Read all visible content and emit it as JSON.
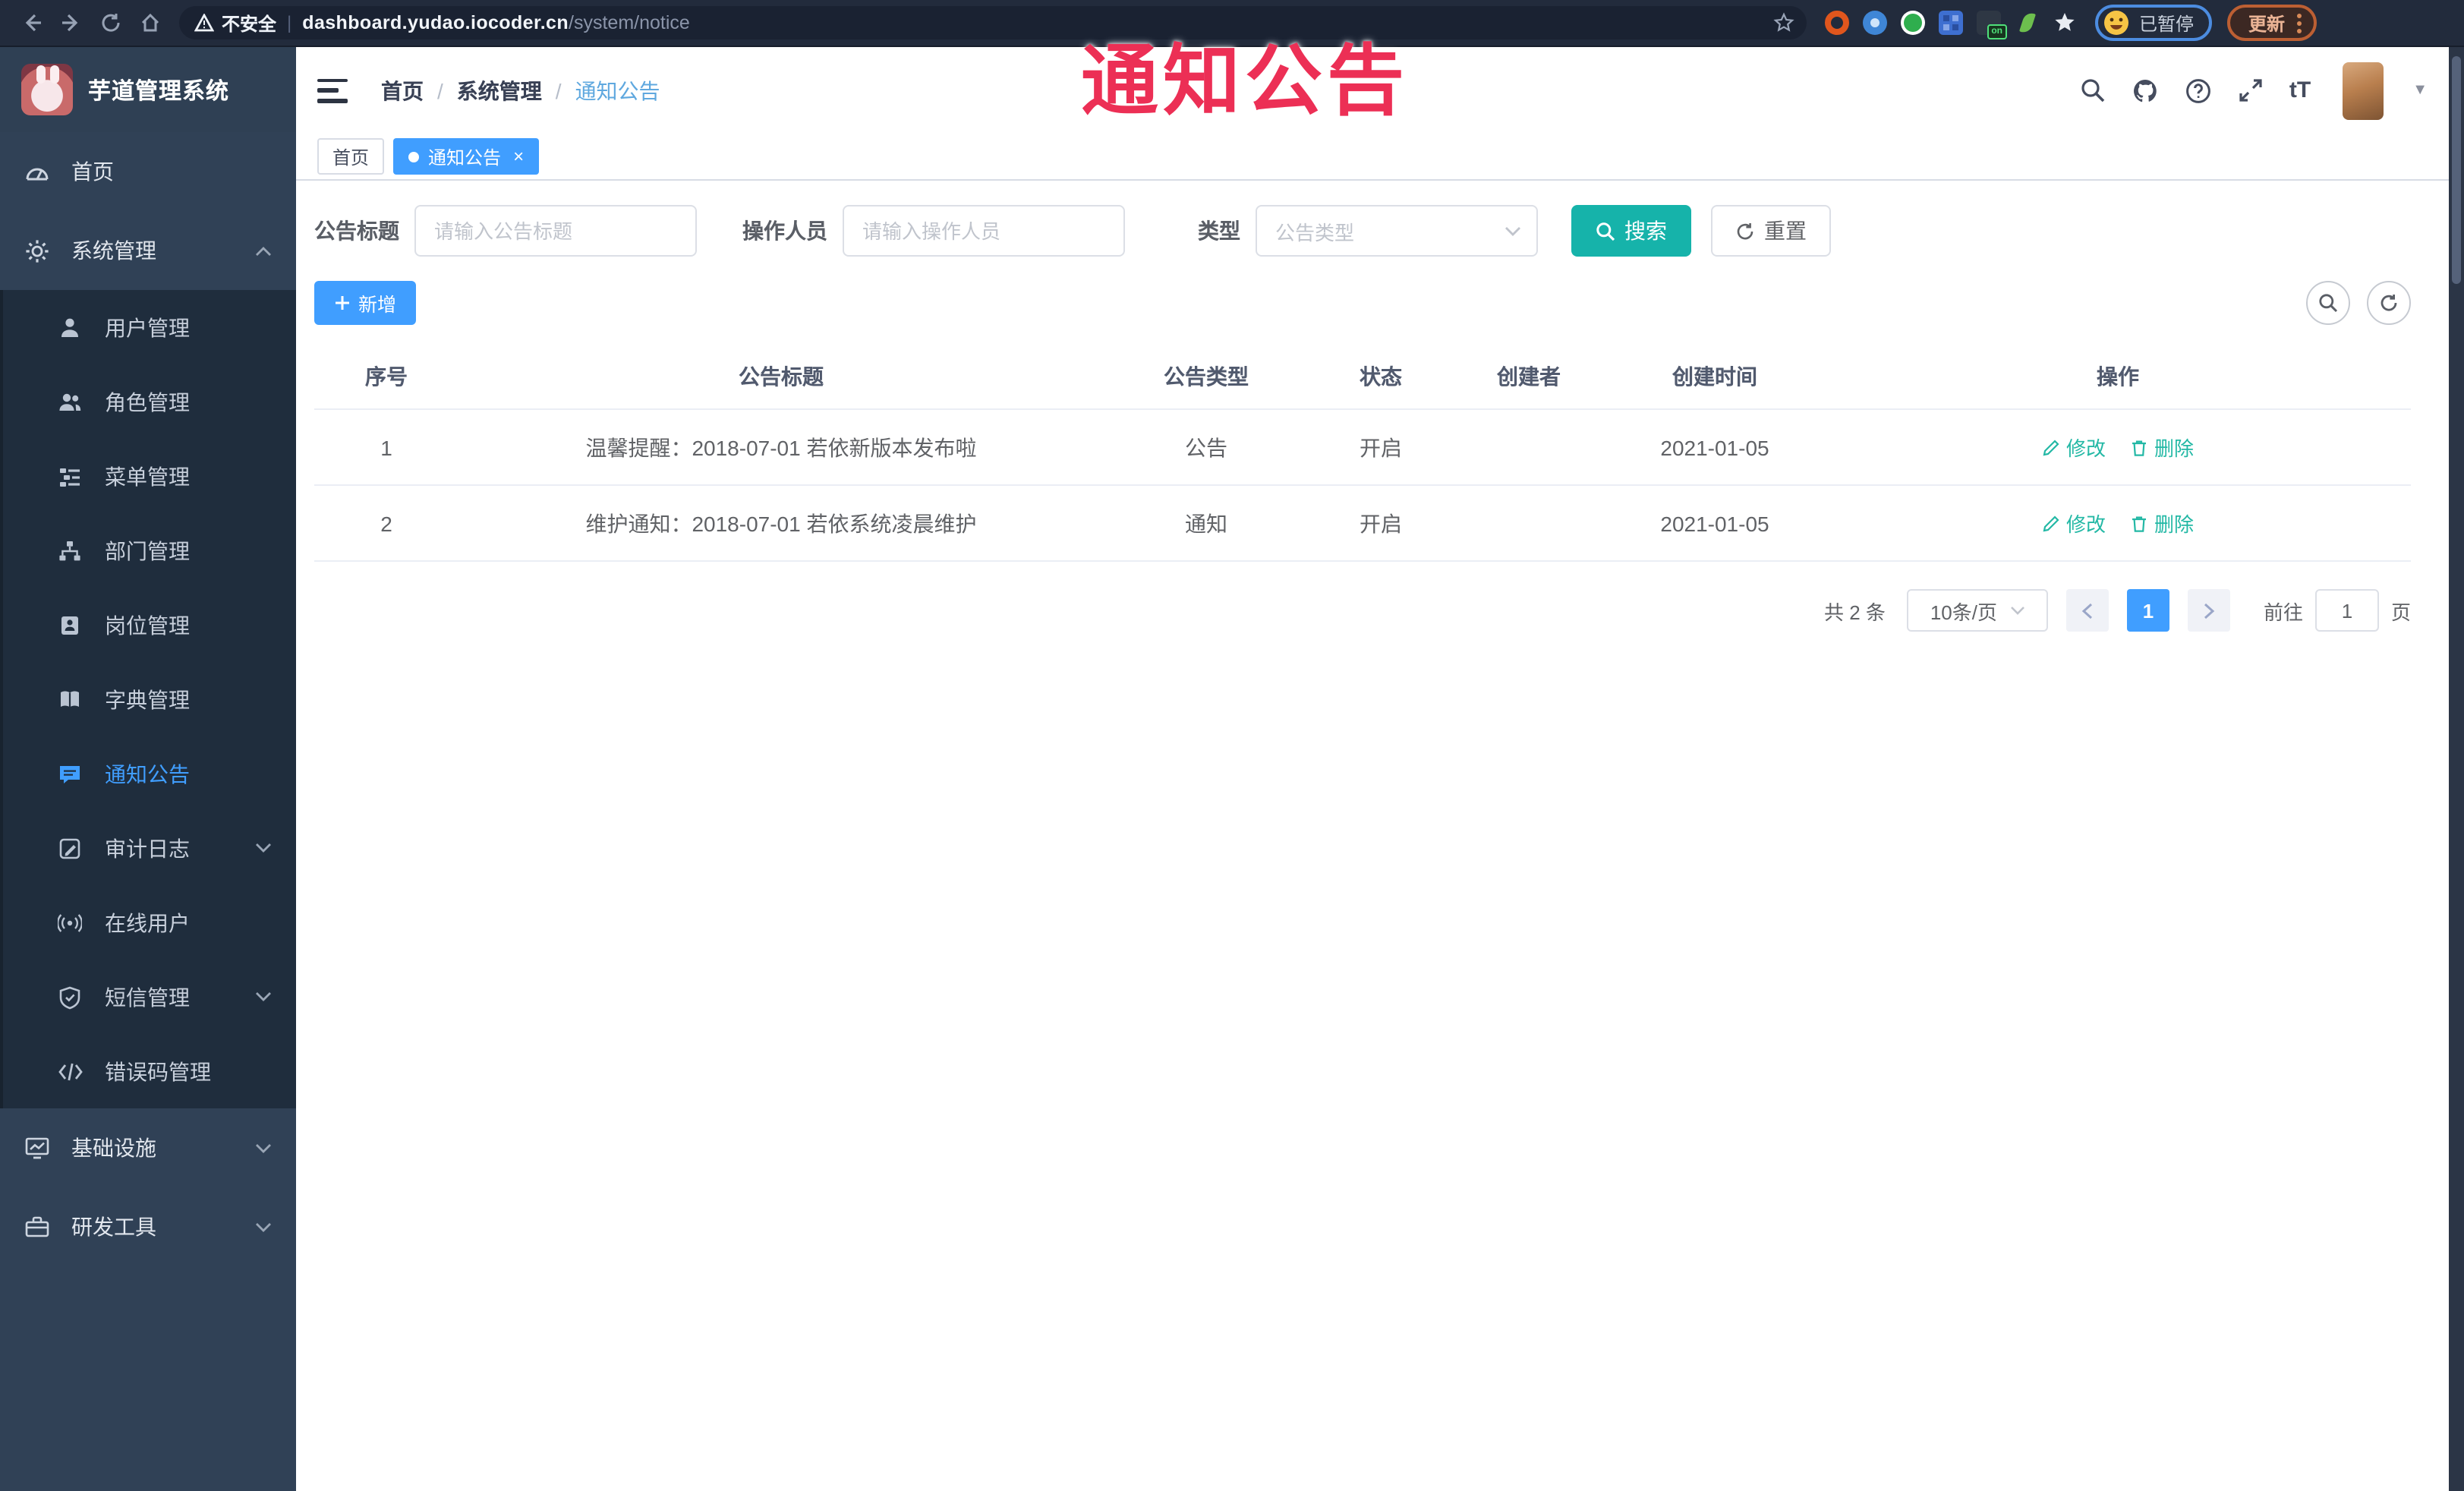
{
  "browser": {
    "security_label": "不安全",
    "url_host": "dashboard.yudao.iocoder.cn",
    "url_path": "/system/notice",
    "profile_chip_label": "已暂停",
    "update_button_label": "更新",
    "ext_on_badge": "on"
  },
  "overlay": {
    "text": "通知公告"
  },
  "sidebar": {
    "title": "芋道管理系统",
    "menu": [
      {
        "label": "首页"
      },
      {
        "label": "系统管理"
      },
      {
        "label": "用户管理"
      },
      {
        "label": "角色管理"
      },
      {
        "label": "菜单管理"
      },
      {
        "label": "部门管理"
      },
      {
        "label": "岗位管理"
      },
      {
        "label": "字典管理"
      },
      {
        "label": "通知公告"
      },
      {
        "label": "审计日志"
      },
      {
        "label": "在线用户"
      },
      {
        "label": "短信管理"
      },
      {
        "label": "错误码管理"
      },
      {
        "label": "基础设施"
      },
      {
        "label": "研发工具"
      }
    ]
  },
  "header": {
    "breadcrumb": [
      "首页",
      "系统管理",
      "通知公告"
    ],
    "font_size_icon_text": "tT"
  },
  "tabs": [
    {
      "label": "首页"
    },
    {
      "label": "通知公告"
    }
  ],
  "filters": {
    "title_label": "公告标题",
    "title_placeholder": "请输入公告标题",
    "operator_label": "操作人员",
    "operator_placeholder": "请输入操作人员",
    "type_label": "类型",
    "type_placeholder": "公告类型",
    "search_button": "搜索",
    "reset_button": "重置"
  },
  "toolbar": {
    "add_button": "新增"
  },
  "table": {
    "columns": [
      "序号",
      "公告标题",
      "公告类型",
      "状态",
      "创建者",
      "创建时间",
      "操作"
    ],
    "rows": [
      {
        "index": "1",
        "title": "温馨提醒：2018-07-01 若依新版本发布啦",
        "type": "公告",
        "status": "开启",
        "creator": "",
        "created_at": "2021-01-05",
        "edit": "修改",
        "delete": "删除"
      },
      {
        "index": "2",
        "title": "维护通知：2018-07-01 若依系统凌晨维护",
        "type": "通知",
        "status": "开启",
        "creator": "",
        "created_at": "2021-01-05",
        "edit": "修改",
        "delete": "删除"
      }
    ]
  },
  "pagination": {
    "total": "共 2 条",
    "page_size": "10条/页",
    "current_page": "1",
    "goto_label": "前往",
    "goto_value": "1",
    "goto_suffix": "页"
  },
  "colors": {
    "primary": "#409eff",
    "search_teal": "#16b3aa",
    "overlay_red": "#ec2f55",
    "sidebar_bg": "#304156",
    "submenu_bg": "#1f2d3d"
  }
}
